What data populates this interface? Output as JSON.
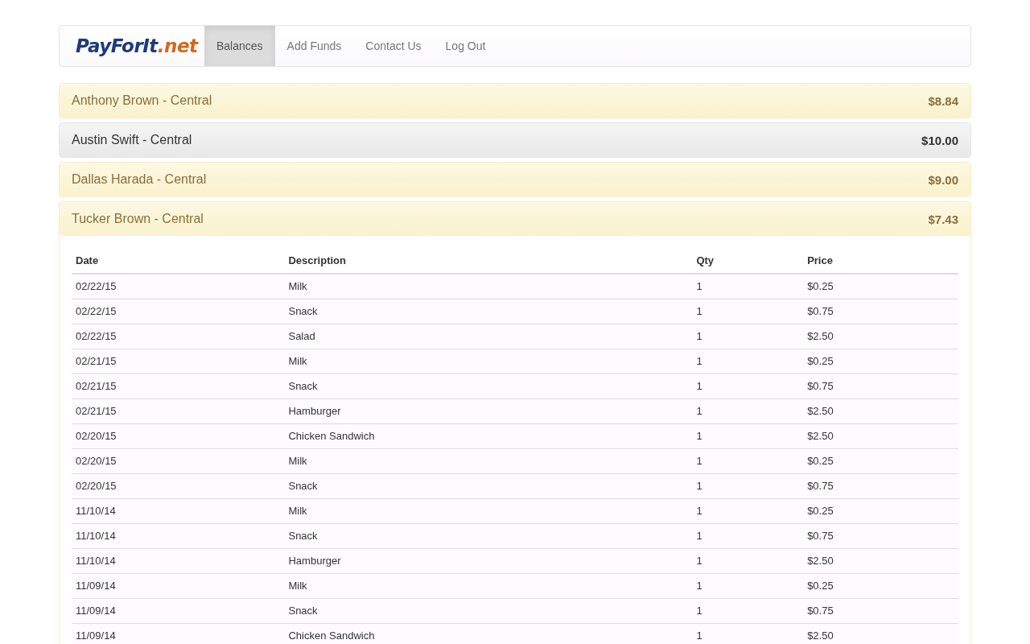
{
  "navbar": {
    "logo": {
      "name": "PayForIt",
      "suffix": ".net"
    },
    "items": [
      {
        "label": "Balances",
        "selected": true
      },
      {
        "label": "Add Funds",
        "selected": false
      },
      {
        "label": "Contact Us",
        "selected": false
      },
      {
        "label": "Log Out",
        "selected": false
      }
    ]
  },
  "accounts": [
    {
      "name": "Anthony Brown - Central",
      "balance": "$8.84",
      "kind": "warning",
      "expanded": false
    },
    {
      "name": "Austin Swift - Central",
      "balance": "$10.00",
      "kind": "default",
      "expanded": false
    },
    {
      "name": "Dallas Harada - Central",
      "balance": "$9.00",
      "kind": "warning",
      "expanded": false
    },
    {
      "name": "Tucker Brown - Central",
      "balance": "$7.43",
      "kind": "warning",
      "expanded": true,
      "table": {
        "columns": [
          "Date",
          "Description",
          "Qty",
          "Price"
        ],
        "rows": [
          [
            "02/22/15",
            "Milk",
            "1",
            "$0.25"
          ],
          [
            "02/22/15",
            "Snack",
            "1",
            "$0.75"
          ],
          [
            "02/22/15",
            "Salad",
            "1",
            "$2.50"
          ],
          [
            "02/21/15",
            "Milk",
            "1",
            "$0.25"
          ],
          [
            "02/21/15",
            "Snack",
            "1",
            "$0.75"
          ],
          [
            "02/21/15",
            "Hamburger",
            "1",
            "$2.50"
          ],
          [
            "02/20/15",
            "Chicken Sandwich",
            "1",
            "$2.50"
          ],
          [
            "02/20/15",
            "Milk",
            "1",
            "$0.25"
          ],
          [
            "02/20/15",
            "Snack",
            "1",
            "$0.75"
          ],
          [
            "11/10/14",
            "Milk",
            "1",
            "$0.25"
          ],
          [
            "11/10/14",
            "Snack",
            "1",
            "$0.75"
          ],
          [
            "11/10/14",
            "Hamburger",
            "1",
            "$2.50"
          ],
          [
            "11/09/14",
            "Milk",
            "1",
            "$0.25"
          ],
          [
            "11/09/14",
            "Snack",
            "1",
            "$0.75"
          ],
          [
            "11/09/14",
            "Chicken Sandwich",
            "1",
            "$2.50"
          ]
        ]
      }
    }
  ]
}
